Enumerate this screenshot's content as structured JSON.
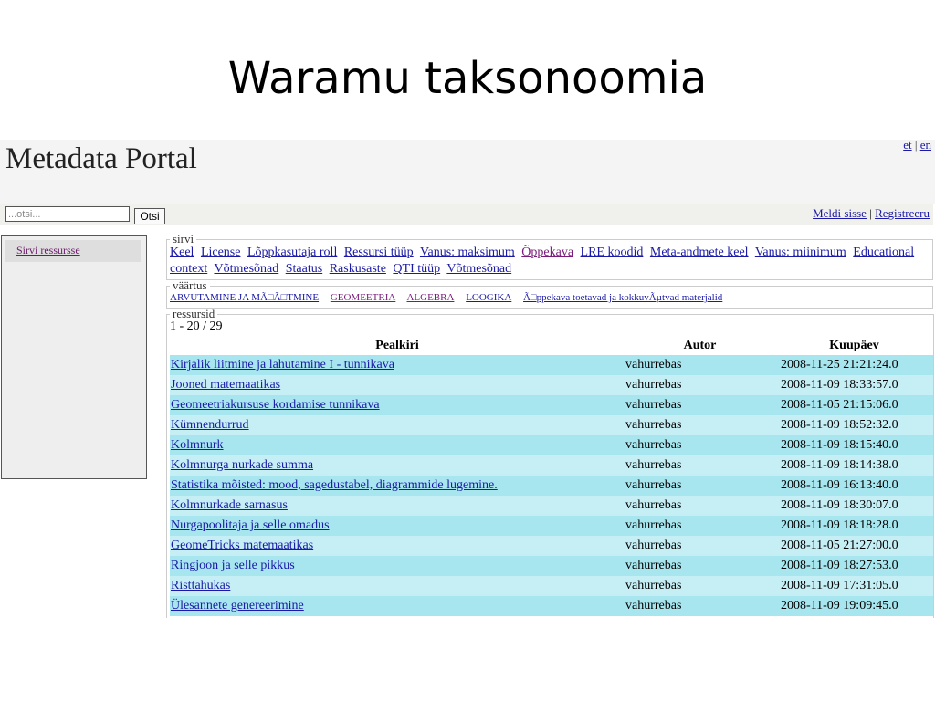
{
  "slide": {
    "title": "Waramu taksonoomia"
  },
  "header": {
    "portal_title": "Metadata Portal",
    "lang_et": "et",
    "lang_sep": "|",
    "lang_en": "en"
  },
  "search": {
    "placeholder": "...otsi...",
    "button_label": "Otsi"
  },
  "auth": {
    "login": "Meldi sisse",
    "sep": "|",
    "register": "Registreeru"
  },
  "sidebar": {
    "items": [
      {
        "label": "Sirvi ressursse"
      }
    ]
  },
  "browse": {
    "legend": "sirvi",
    "links": [
      {
        "label": "Keel",
        "visited": false
      },
      {
        "label": "License",
        "visited": false
      },
      {
        "label": "Lõppkasutaja roll",
        "visited": false
      },
      {
        "label": "Ressursi tüüp",
        "visited": false
      },
      {
        "label": "Vanus: maksimum",
        "visited": false
      },
      {
        "label": "Õppekava",
        "visited": true
      },
      {
        "label": "LRE koodid",
        "visited": false
      },
      {
        "label": "Meta-andmete keel",
        "visited": false
      },
      {
        "label": "Vanus: miinimum",
        "visited": false
      },
      {
        "label": "Educational context",
        "visited": false
      },
      {
        "label": "Võtmesõnad",
        "visited": false
      },
      {
        "label": "Staatus",
        "visited": false
      },
      {
        "label": "Raskusaste",
        "visited": false
      },
      {
        "label": "QTI tüüp",
        "visited": false
      },
      {
        "label": "Võtmesõnad",
        "visited": false
      }
    ]
  },
  "values": {
    "legend": "väärtus",
    "links": [
      {
        "label": "ARVUTAMINE JA MÃ□Ã□TMINE",
        "visited": false
      },
      {
        "label": "GEOMEETRIA",
        "visited": true
      },
      {
        "label": "ALGEBRA",
        "visited": true
      },
      {
        "label": "LOOGIKA",
        "visited": false
      },
      {
        "label": "Ã□ppekava toetavad ja kokkuvÃµtvad materjalid",
        "visited": false
      }
    ]
  },
  "resources": {
    "legend": "ressursid",
    "count": "1 - 20 / 29",
    "columns": [
      "Pealkiri",
      "Autor",
      "Kuupäev"
    ],
    "rows": [
      {
        "title": "Kirjalik liitmine ja lahutamine I - tunnikava",
        "author": "vahurrebas",
        "date": "2008-11-25 21:21:24.0"
      },
      {
        "title": "Jooned matemaatikas",
        "author": "vahurrebas",
        "date": "2008-11-09 18:33:57.0"
      },
      {
        "title": "Geomeetriakursuse kordamise tunnikava",
        "author": "vahurrebas",
        "date": "2008-11-05 21:15:06.0"
      },
      {
        "title": "Kümnendurrud",
        "author": "vahurrebas",
        "date": "2008-11-09 18:52:32.0"
      },
      {
        "title": "Kolmnurk",
        "author": "vahurrebas",
        "date": "2008-11-09 18:15:40.0"
      },
      {
        "title": "Kolmnurga nurkade summa",
        "author": "vahurrebas",
        "date": "2008-11-09 18:14:38.0"
      },
      {
        "title": "Statistika mõisted: mood, sagedustabel, diagrammide lugemine.",
        "author": "vahurrebas",
        "date": "2008-11-09 16:13:40.0"
      },
      {
        "title": "Kolmnurkade sarnasus",
        "author": "vahurrebas",
        "date": "2008-11-09 18:30:07.0"
      },
      {
        "title": "Nurgapoolitaja ja selle omadus",
        "author": "vahurrebas",
        "date": "2008-11-09 18:18:28.0"
      },
      {
        "title": "GeomeTricks matemaatikas",
        "author": "vahurrebas",
        "date": "2008-11-05 21:27:00.0"
      },
      {
        "title": "Ringjoon ja selle pikkus",
        "author": "vahurrebas",
        "date": "2008-11-09 18:27:53.0"
      },
      {
        "title": "Risttahukas",
        "author": "vahurrebas",
        "date": "2008-11-09 17:31:05.0"
      },
      {
        "title": "Ülesannete genereerimine",
        "author": "vahurrebas",
        "date": "2008-11-09 19:09:45.0"
      }
    ]
  }
}
